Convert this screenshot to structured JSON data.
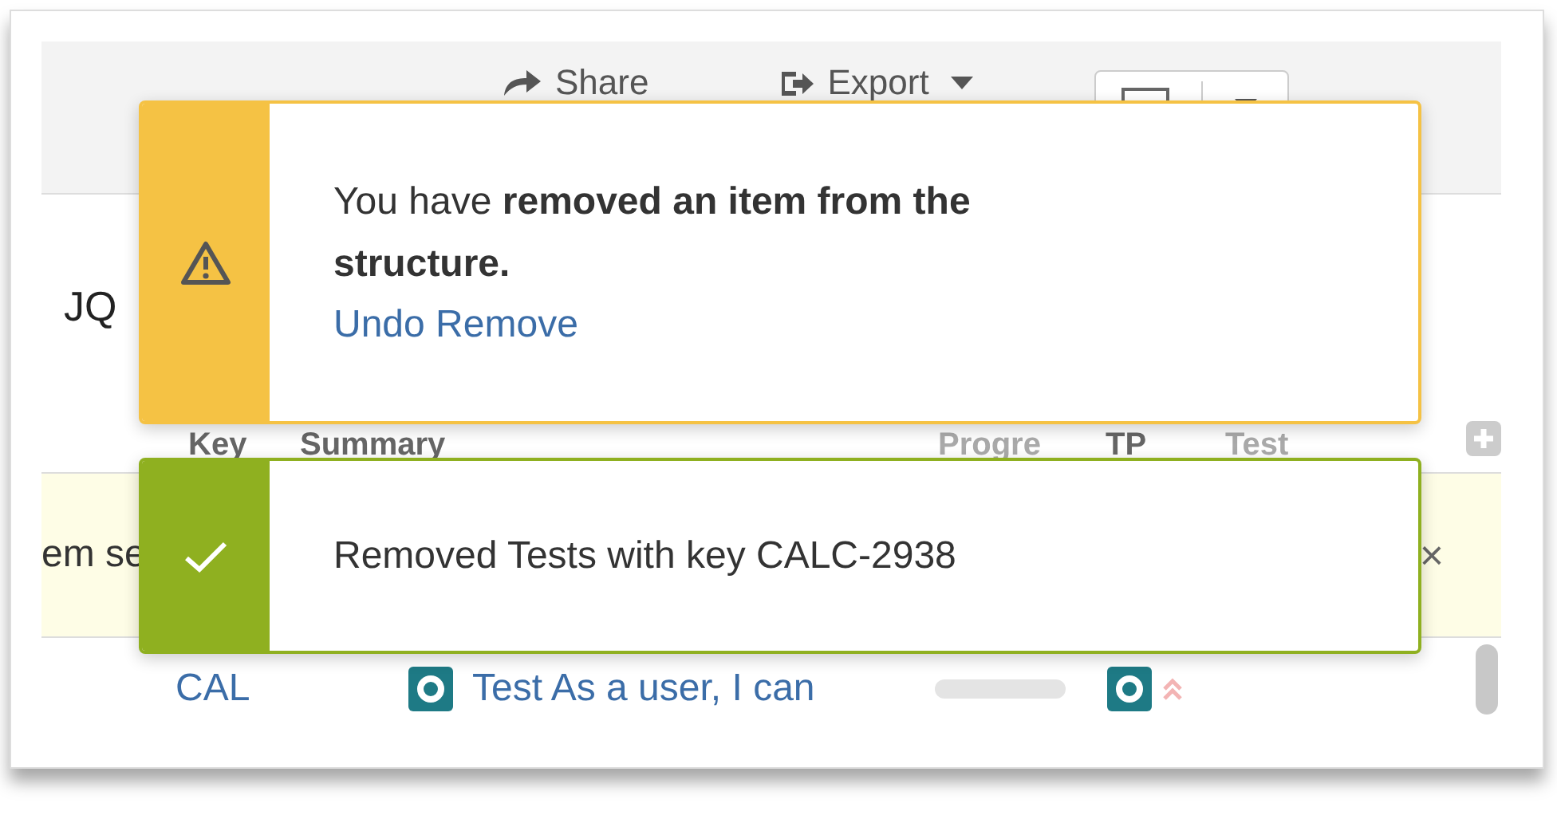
{
  "toolbar": {
    "buttons": [
      {
        "label": "Share",
        "kind": "share"
      },
      {
        "label": "Export",
        "kind": "export"
      }
    ]
  },
  "page_title": "JQ",
  "table": {
    "columns": [
      {
        "label": "Key",
        "faded": false
      },
      {
        "label": "Summary",
        "faded": false
      },
      {
        "label": "Progre",
        "faded": true
      },
      {
        "label": "TP",
        "faded": false
      },
      {
        "label": "Test",
        "faded": true
      }
    ],
    "banner": {
      "text": "em se",
      "close": "×"
    },
    "rows": [
      {
        "key": "CAL",
        "summary": "Test As a user, I can",
        "level": 0
      }
    ]
  },
  "toasts": [
    {
      "kind": "warning",
      "message": "You have **removed an item from the structure.**",
      "link": "Undo Remove"
    },
    {
      "kind": "success",
      "message": "Removed Tests with key CALC-2938"
    }
  ]
}
